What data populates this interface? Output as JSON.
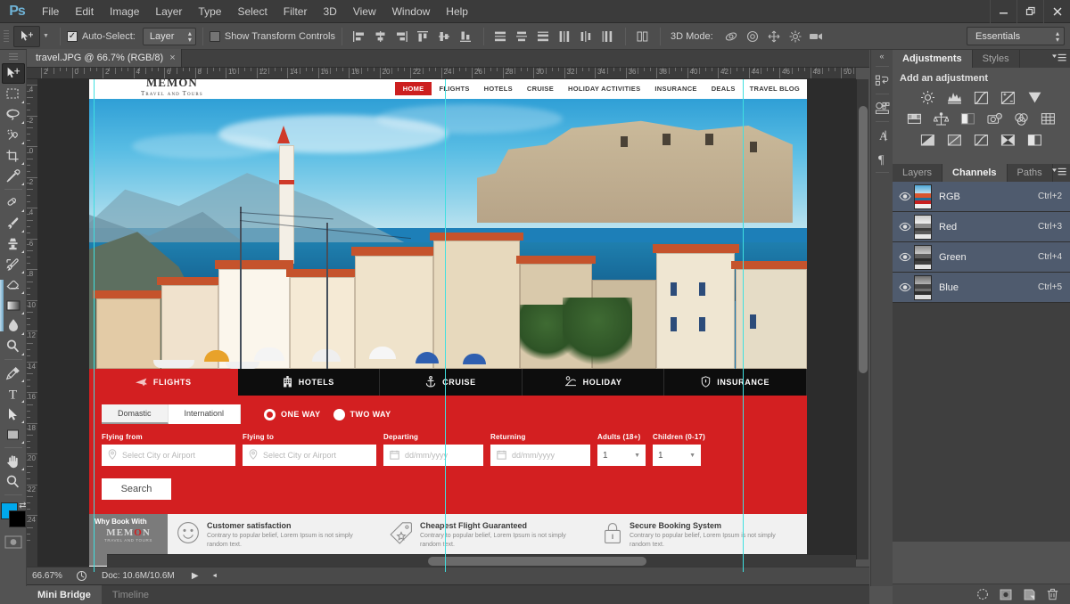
{
  "app": {
    "name": "Adobe Photoshop",
    "logo": "Ps",
    "menus": [
      "File",
      "Edit",
      "Image",
      "Layer",
      "Type",
      "Select",
      "Filter",
      "3D",
      "View",
      "Window",
      "Help"
    ],
    "window_controls": {
      "minimize": "–",
      "restore": "❐",
      "close": "✕"
    }
  },
  "options_bar": {
    "tool_icon": "move-tool-icon",
    "auto_select_label": "Auto-Select:",
    "auto_select_checked": true,
    "auto_select_scope": "Layer",
    "show_transform_label": "Show Transform Controls",
    "show_transform_checked": false,
    "mode3d_label": "3D Mode:",
    "workspace": "Essentials"
  },
  "document": {
    "tab_title": "travel.JPG @ 66.7% (RGB/8)",
    "close_glyph": "×"
  },
  "rulers": {
    "h_labels": [
      "2",
      "0",
      "2",
      "4",
      "6",
      "8",
      "10",
      "12",
      "14",
      "16",
      "18",
      "20",
      "22",
      "24",
      "26",
      "28",
      "30",
      "32",
      "34",
      "36",
      "38",
      "40",
      "42",
      "44",
      "46",
      "48",
      "50"
    ],
    "v_labels": [
      "4",
      "2",
      "0",
      "2",
      "4",
      "6",
      "8",
      "10",
      "12",
      "14",
      "16",
      "18",
      "20",
      "22",
      "24"
    ]
  },
  "status_bar": {
    "zoom": "66.67%",
    "doc_info": "Doc: 10.6M/10.6M"
  },
  "bottom_tabs": [
    {
      "label": "Mini Bridge",
      "active": true
    },
    {
      "label": "Timeline",
      "active": false
    }
  ],
  "toolbar": {
    "tools": [
      {
        "name": "move-tool",
        "active": true,
        "has_submenu": false
      },
      {
        "name": "rectangular-marquee-tool",
        "active": false,
        "has_submenu": true
      },
      {
        "name": "lasso-tool",
        "active": false,
        "has_submenu": true
      },
      {
        "name": "quick-selection-tool",
        "active": false,
        "has_submenu": true
      },
      {
        "name": "crop-tool",
        "active": false,
        "has_submenu": true
      },
      {
        "name": "eyedropper-tool",
        "active": false,
        "has_submenu": true
      },
      {
        "name": "spot-healing-brush-tool",
        "active": false,
        "has_submenu": true
      },
      {
        "name": "brush-tool",
        "active": false,
        "has_submenu": true
      },
      {
        "name": "clone-stamp-tool",
        "active": false,
        "has_submenu": true
      },
      {
        "name": "history-brush-tool",
        "active": false,
        "has_submenu": true
      },
      {
        "name": "eraser-tool",
        "active": false,
        "has_submenu": true
      },
      {
        "name": "gradient-tool",
        "active": false,
        "has_submenu": true
      },
      {
        "name": "blur-tool",
        "active": false,
        "has_submenu": true
      },
      {
        "name": "dodge-tool",
        "active": false,
        "has_submenu": true
      },
      {
        "name": "pen-tool",
        "active": false,
        "has_submenu": true
      },
      {
        "name": "horizontal-type-tool",
        "active": false,
        "has_submenu": true
      },
      {
        "name": "path-selection-tool",
        "active": false,
        "has_submenu": true
      },
      {
        "name": "rectangle-tool",
        "active": false,
        "has_submenu": true
      },
      {
        "name": "hand-tool",
        "active": false,
        "has_submenu": true
      },
      {
        "name": "zoom-tool",
        "active": false,
        "has_submenu": false
      }
    ],
    "foreground_color": "#00a8ec",
    "background_color": "#000000"
  },
  "dock_strip": {
    "collapse_glyph": "«",
    "icons": [
      "history-panel-icon",
      "color-panel-icon",
      "character-panel-icon",
      "paragraph-panel-icon"
    ],
    "character_glyph": "A",
    "paragraph_glyph": "¶"
  },
  "adjustments_panel": {
    "tabs": [
      {
        "label": "Adjustments",
        "active": true
      },
      {
        "label": "Styles",
        "active": false
      }
    ],
    "title": "Add an adjustment",
    "icons": [
      [
        "brightness-contrast-icon",
        "levels-icon",
        "curves-icon",
        "exposure-icon",
        "vibrance-icon"
      ],
      [
        "hue-saturation-icon",
        "color-balance-icon",
        "black-white-icon",
        "photo-filter-icon",
        "channel-mixer-icon",
        "color-lookup-icon"
      ],
      [
        "invert-icon",
        "posterize-icon",
        "threshold-icon",
        "gradient-map-icon",
        "selective-color-icon"
      ]
    ]
  },
  "channels_panel": {
    "tabs": [
      {
        "label": "Layers",
        "active": false
      },
      {
        "label": "Channels",
        "active": true
      },
      {
        "label": "Paths",
        "active": false
      }
    ],
    "rows": [
      {
        "name": "RGB",
        "shortcut": "Ctrl+2",
        "visible": true,
        "selected": true,
        "thumb": "composite"
      },
      {
        "name": "Red",
        "shortcut": "Ctrl+3",
        "visible": true,
        "selected": true,
        "thumb": "gray"
      },
      {
        "name": "Green",
        "shortcut": "Ctrl+4",
        "visible": true,
        "selected": true,
        "thumb": "gray"
      },
      {
        "name": "Blue",
        "shortcut": "Ctrl+5",
        "visible": true,
        "selected": true,
        "thumb": "gray"
      }
    ],
    "footer_buttons": [
      "load-channel-as-selection-icon",
      "save-selection-as-channel-icon",
      "new-channel-icon",
      "delete-channel-icon"
    ]
  },
  "canvas": {
    "site": {
      "brand_name": "MEMON",
      "brand_tagline": "Travel and Tours",
      "top_nav": [
        {
          "label": "HOME",
          "active": true
        },
        {
          "label": "FLIGHTS",
          "active": false
        },
        {
          "label": "HOTELS",
          "active": false
        },
        {
          "label": "CRUISE",
          "active": false
        },
        {
          "label": "HOLIDAY ACTIVITIES",
          "active": false
        },
        {
          "label": "INSURANCE",
          "active": false
        },
        {
          "label": "DEALS",
          "active": false
        },
        {
          "label": "TRAVEL BLOG",
          "active": false
        }
      ],
      "booking_tabs": [
        {
          "label": "FLIGHTS",
          "icon": "plane-icon",
          "active": true
        },
        {
          "label": "HOTELS",
          "icon": "hotel-icon",
          "active": false
        },
        {
          "label": "CRUISE",
          "icon": "anchor-icon",
          "active": false
        },
        {
          "label": "HOLIDAY",
          "icon": "beach-icon",
          "active": false
        },
        {
          "label": "INSURANCE",
          "icon": "shield-icon",
          "active": false
        }
      ],
      "trip_scope": [
        {
          "label": "Domastic",
          "active": true
        },
        {
          "label": "Internationl",
          "active": false
        }
      ],
      "trip_type": [
        {
          "label": "ONE WAY",
          "selected": true
        },
        {
          "label": "TWO WAY",
          "selected": false
        }
      ],
      "fields": [
        {
          "label": "Flying from",
          "placeholder": "Select City or Airport",
          "icon": "location-pin-icon"
        },
        {
          "label": "Flying to",
          "placeholder": "Select City or Airport",
          "icon": "location-pin-icon"
        },
        {
          "label": "Departing",
          "placeholder": "dd/mm/yyyy",
          "icon": "calendar-icon"
        },
        {
          "label": "Returning",
          "placeholder": "dd/mm/yyyy",
          "icon": "calendar-icon"
        }
      ],
      "passengers": [
        {
          "label": "Adults (18+)",
          "value": "1"
        },
        {
          "label": "Children (0-17)",
          "value": "1"
        }
      ],
      "search_button": "Search",
      "why_book_label": "Why Book With",
      "why_book_brand": "MEMON",
      "why_book_tag": "TRAVEL AND TOURS",
      "features": [
        {
          "icon": "smiley-icon",
          "title": "Customer satisfaction",
          "text": "Contrary to popular belief, Lorem Ipsum is not simply random text."
        },
        {
          "icon": "price-tag-icon",
          "title": "Cheapest Flight Guaranteed",
          "text": "Contrary to popular belief, Lorem Ipsum is not simply random text."
        },
        {
          "icon": "lock-icon",
          "title": "Secure Booking System",
          "text": "Contrary to popular belief, Lorem Ipsum is not simply random text."
        }
      ]
    },
    "guide_color": "#3fe0e0",
    "guides_x": [
      5,
      418,
      745
    ]
  },
  "colors": {
    "brand_red": "#d31f21",
    "panel_bg": "#535353",
    "menu_bg": "#3b3b3b",
    "selection_blue": "#4f5b6e",
    "logo_blue": "#6fb3d6"
  }
}
